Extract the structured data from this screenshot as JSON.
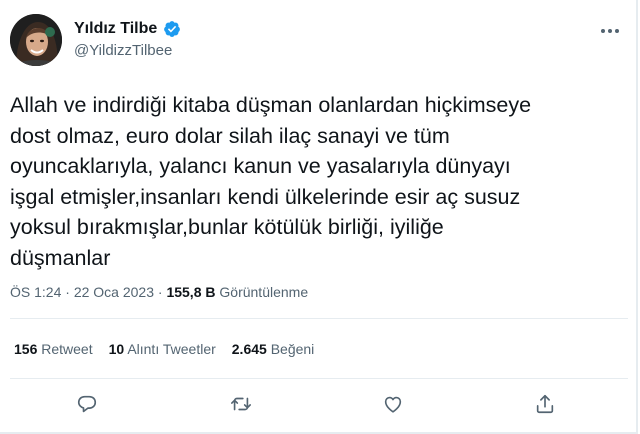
{
  "user": {
    "display_name": "Yıldız Tilbe",
    "handle": "@YildizzTilbee",
    "verified": true
  },
  "tweet": {
    "lines": [
      "Allah ve indirdiği kitaba düşman olanlardan hiçkimseye",
      "dost olmaz, euro dolar silah ilaç sanayi ve tüm",
      "oyuncaklarıyla, yalancı kanun ve yasalarıyla dünyayı",
      "işgal etmişler,insanları kendi ülkelerinde esir aç susuz",
      "yoksul bırakmışlar,bunlar kötülük birliği,  iyiliğe",
      "düşmanlar"
    ]
  },
  "meta": {
    "time": "ÖS 1:24",
    "separator": "·",
    "date": "22 Oca 2023",
    "views_count": "155,8 B",
    "views_label": "Görüntülenme"
  },
  "stats": {
    "retweets_count": "156",
    "retweets_label": "Retweet",
    "quotes_count": "10",
    "quotes_label": "Alıntı Tweetler",
    "likes_count": "2.645",
    "likes_label": "Beğeni"
  },
  "icons": {
    "verified": "verified-badge-icon",
    "more": "more-options-icon",
    "reply": "reply-icon",
    "retweet": "retweet-icon",
    "like": "heart-icon",
    "share": "share-icon"
  },
  "colors": {
    "verified": "#1d9bf0",
    "text": "#0f1419",
    "secondary": "#536471",
    "divider": "#e6ecf0"
  }
}
